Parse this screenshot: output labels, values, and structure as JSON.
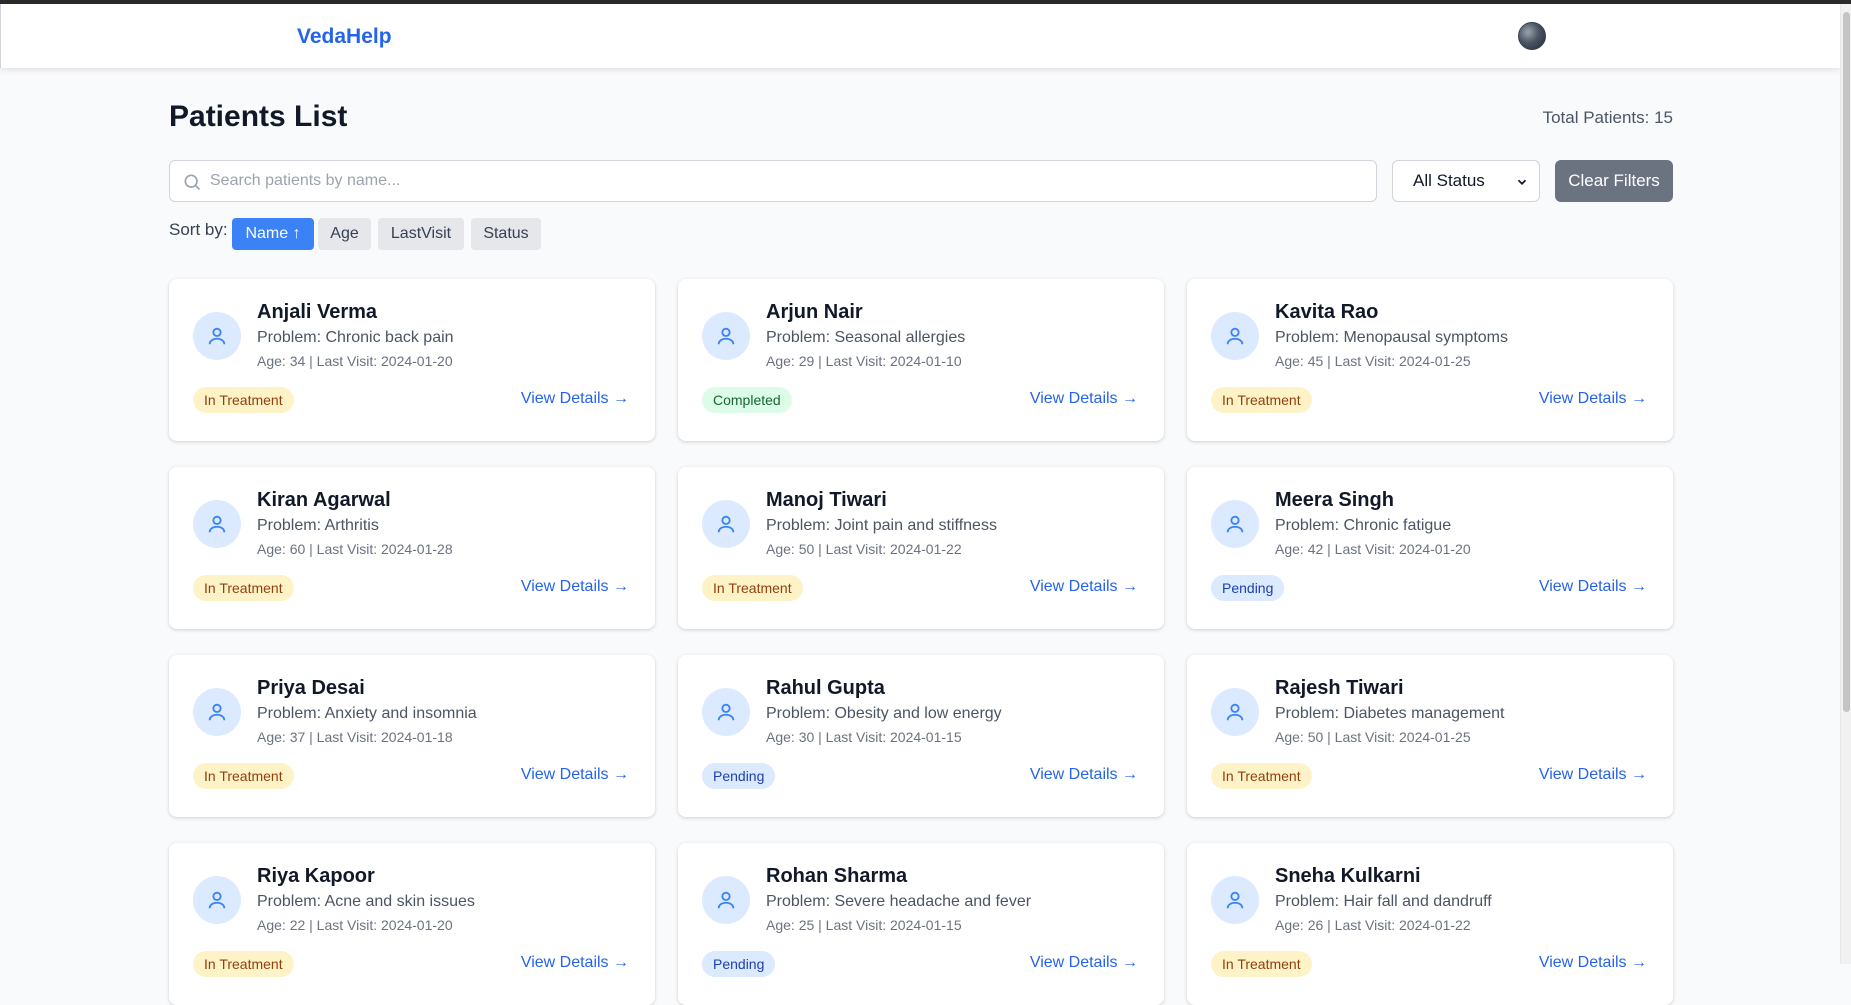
{
  "app": {
    "brand": "VedaHelp"
  },
  "page": {
    "title": "Patients List",
    "total": "Total Patients: 15"
  },
  "filters": {
    "search_placeholder": "Search patients by name...",
    "search_value": "",
    "status_selected": "All Status",
    "clear_label": "Clear Filters"
  },
  "sort": {
    "label": "Sort by:",
    "options": [
      "Name ↑",
      "Age",
      "LastVisit",
      "Status"
    ],
    "active": "Name ↑"
  },
  "view_details_label": "View Details →",
  "colors": {
    "brand": "#2563eb",
    "active_sort": "#3b82f6",
    "clear_button": "#6b7280"
  },
  "patients": [
    {
      "name": "Anjali Verma",
      "problem": "Problem: Chronic back pain",
      "meta": "Age: 34 | Last Visit: 2024-01-20",
      "status": "In Treatment"
    },
    {
      "name": "Arjun Nair",
      "problem": "Problem: Seasonal allergies",
      "meta": "Age: 29 | Last Visit: 2024-01-10",
      "status": "Completed"
    },
    {
      "name": "Kavita Rao",
      "problem": "Problem: Menopausal symptoms",
      "meta": "Age: 45 | Last Visit: 2024-01-25",
      "status": "In Treatment"
    },
    {
      "name": "Kiran Agarwal",
      "problem": "Problem: Arthritis",
      "meta": "Age: 60 | Last Visit: 2024-01-28",
      "status": "In Treatment"
    },
    {
      "name": "Manoj Tiwari",
      "problem": "Problem: Joint pain and stiffness",
      "meta": "Age: 50 | Last Visit: 2024-01-22",
      "status": "In Treatment"
    },
    {
      "name": "Meera Singh",
      "problem": "Problem: Chronic fatigue",
      "meta": "Age: 42 | Last Visit: 2024-01-20",
      "status": "Pending"
    },
    {
      "name": "Priya Desai",
      "problem": "Problem: Anxiety and insomnia",
      "meta": "Age: 37 | Last Visit: 2024-01-18",
      "status": "In Treatment"
    },
    {
      "name": "Rahul Gupta",
      "problem": "Problem: Obesity and low energy",
      "meta": "Age: 30 | Last Visit: 2024-01-15",
      "status": "Pending"
    },
    {
      "name": "Rajesh Tiwari",
      "problem": "Problem: Diabetes management",
      "meta": "Age: 50 | Last Visit: 2024-01-25",
      "status": "In Treatment"
    },
    {
      "name": "Riya Kapoor",
      "problem": "Problem: Acne and skin issues",
      "meta": "Age: 22 | Last Visit: 2024-01-20",
      "status": "In Treatment"
    },
    {
      "name": "Rohan Sharma",
      "problem": "Problem: Severe headache and fever",
      "meta": "Age: 25 | Last Visit: 2024-01-15",
      "status": "Pending"
    },
    {
      "name": "Sneha Kulkarni",
      "problem": "Problem: Hair fall and dandruff",
      "meta": "Age: 26 | Last Visit: 2024-01-22",
      "status": "In Treatment"
    }
  ]
}
